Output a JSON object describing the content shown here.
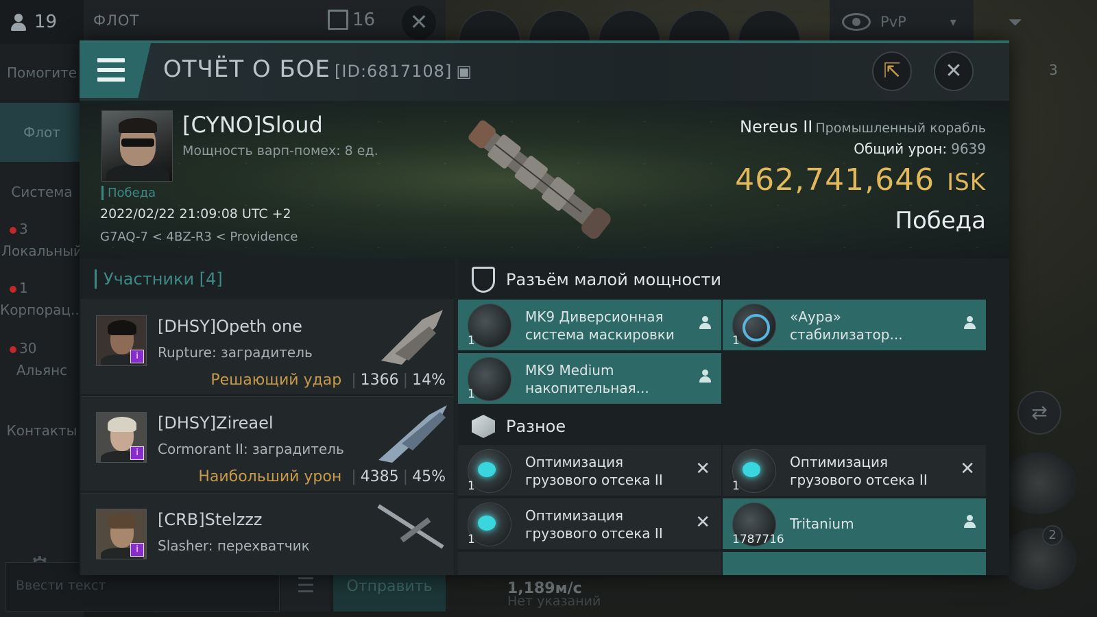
{
  "topbar": {
    "online_count": "19",
    "fleet_label": "ФЛОТ",
    "fleet_count": "16",
    "pvp_label": "PvP"
  },
  "sidebar": {
    "items": [
      {
        "label": "Помогите"
      },
      {
        "label": "Флот"
      },
      {
        "label": "Система"
      },
      {
        "label": "Локальный",
        "badge": "3"
      },
      {
        "label": "Корпорац...",
        "badge": "1"
      },
      {
        "label": "Альянс",
        "badge": "30"
      },
      {
        "label": "Контакты"
      }
    ],
    "chat_placeholder": "Ввести текст",
    "send_label": "Отправить"
  },
  "background": {
    "speed": "1,189м/с",
    "no_orders": "Нет указаний",
    "right_badge": "2",
    "fleet_badge": "3"
  },
  "modal": {
    "title": "ОТЧЁТ О БОЕ",
    "report_id": "[ID:6817108]",
    "pilot": {
      "name": "[CYNO]Sloud",
      "warp": "Мощность варп-помех: 8 ед.",
      "status": "Победа",
      "datetime": "2022/02/22 21:09:08 UTC +2",
      "location": "G7AQ-7 < 4BZ-R3 < Providence"
    },
    "ship": {
      "name": "Nereus II",
      "class": "Промышленный корабль",
      "total_damage_label": "Общий урон:",
      "total_damage": "9639",
      "isk_value": "462,741,646",
      "isk_unit": "ISK",
      "result": "Победа"
    },
    "participants": {
      "header": "Участники [4]",
      "list": [
        {
          "name": "[DHSY]Opeth one",
          "ship": "Rupture: заградитель",
          "tag": "Решающий удар",
          "damage": "1366",
          "percent": "14%"
        },
        {
          "name": "[DHSY]Zireael",
          "ship": "Cormorant II: заградитель",
          "tag": "Наибольший урон",
          "damage": "4385",
          "percent": "45%"
        },
        {
          "name": "[CRB]Stelzzz",
          "ship": "Slasher: перехватчик",
          "tag": "",
          "damage": "",
          "percent": ""
        }
      ]
    },
    "sections": {
      "low_slot": "Разъём малой мощности",
      "misc": "Разное"
    },
    "low_items": [
      {
        "qty": "1",
        "label": "MK9 Диверсионная система маскировки",
        "status": "dropped"
      },
      {
        "qty": "1",
        "label": "«Аура» стабилизатор...",
        "status": "dropped"
      },
      {
        "qty": "1",
        "label": "MK9 Medium накопительная...",
        "status": "dropped"
      }
    ],
    "misc_items": [
      {
        "qty": "1",
        "label": "Оптимизация грузового отсека II",
        "status": "destroyed"
      },
      {
        "qty": "1",
        "label": "Оптимизация грузового отсека II",
        "status": "destroyed"
      },
      {
        "qty": "1",
        "label": "Оптимизация грузового отсека II",
        "status": "destroyed"
      },
      {
        "qty": "1787716",
        "label": "Tritanium",
        "status": "dropped"
      }
    ]
  }
}
